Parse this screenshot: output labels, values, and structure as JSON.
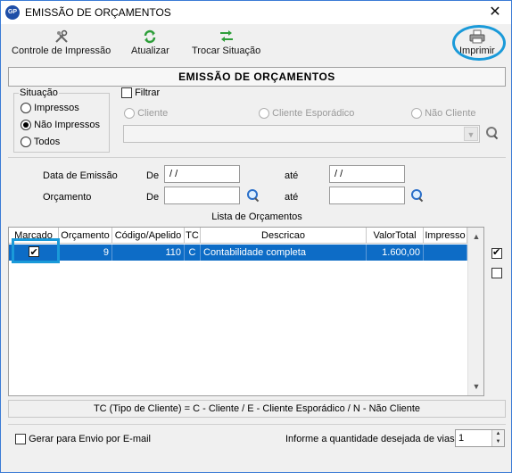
{
  "window": {
    "app_icon_text": "GP",
    "title": "EMISSÃO DE ORÇAMENTOS",
    "close_glyph": "✕"
  },
  "toolbar": {
    "controle": "Controle de Impressão",
    "atualizar": "Atualizar",
    "trocar": "Trocar Situação",
    "imprimir": "Imprimir"
  },
  "header": {
    "title": "EMISSÃO DE ORÇAMENTOS"
  },
  "situacao": {
    "legend": "Situação",
    "options": [
      "Impressos",
      "Não Impressos",
      "Todos"
    ],
    "selected": "Não Impressos"
  },
  "filtro": {
    "label": "Filtrar",
    "checked": false,
    "options": [
      "Cliente",
      "Cliente Esporádico",
      "Não Cliente"
    ],
    "combo_value": ""
  },
  "datas": {
    "emissao_label": "Data de Emissão",
    "orcamento_label": "Orçamento",
    "de_label": "De",
    "ate_label": "até",
    "emissao_de": " / /",
    "emissao_ate": " / /",
    "orcamento_de": "",
    "orcamento_ate": ""
  },
  "grid": {
    "title": "Lista de Orçamentos",
    "columns": [
      "Marcado",
      "Orçamento",
      "Código/Apelido",
      "TC",
      "Descricao",
      "ValorTotal",
      "Impresso"
    ],
    "rows": [
      {
        "marcado": true,
        "orcamento": "9",
        "codigo": "110",
        "tc": "C",
        "descricao": "Contabilidade completa",
        "valor": "1.600,00",
        "impresso": ""
      }
    ]
  },
  "legend_text": "TC (Tipo de Cliente) = C - Cliente / E - Cliente Esporádico / N - Não Cliente",
  "footer": {
    "email_label": "Gerar para Envio por E-mail",
    "email_checked": false,
    "vias_label": "Informe a quantidade desejada de vias",
    "vias_value": "1"
  },
  "colors": {
    "selection": "#0d6cc6",
    "annotation": "#1a9ad9"
  }
}
